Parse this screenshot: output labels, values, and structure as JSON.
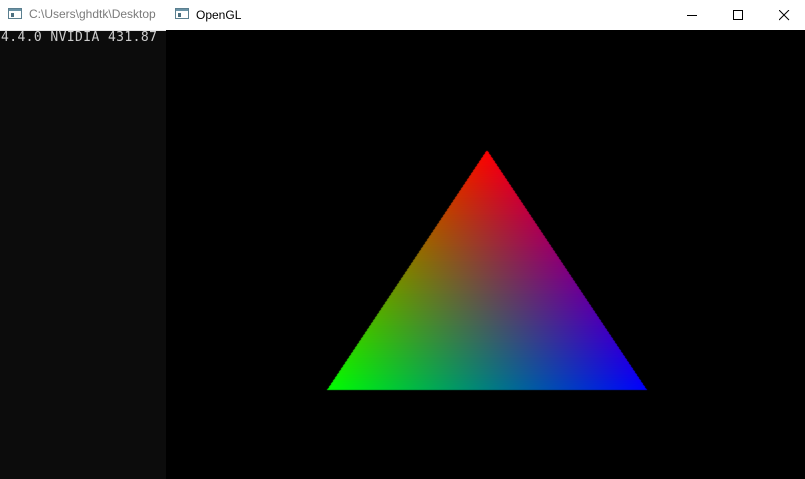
{
  "console": {
    "title": "C:\\Users\\ghdtk\\Desktop",
    "output_line": "4.4.0 NVIDIA 431.87"
  },
  "gl_window": {
    "title": "OpenGL",
    "controls": {
      "minimize_icon": "minimize-icon",
      "maximize_icon": "maximize-icon",
      "close_icon": "close-icon"
    },
    "scene": {
      "shape": "triangle",
      "vertex_colors": {
        "top": "#ff0000",
        "bottom_left": "#00ff00",
        "bottom_right": "#0000ff"
      },
      "background": "#000000"
    }
  }
}
